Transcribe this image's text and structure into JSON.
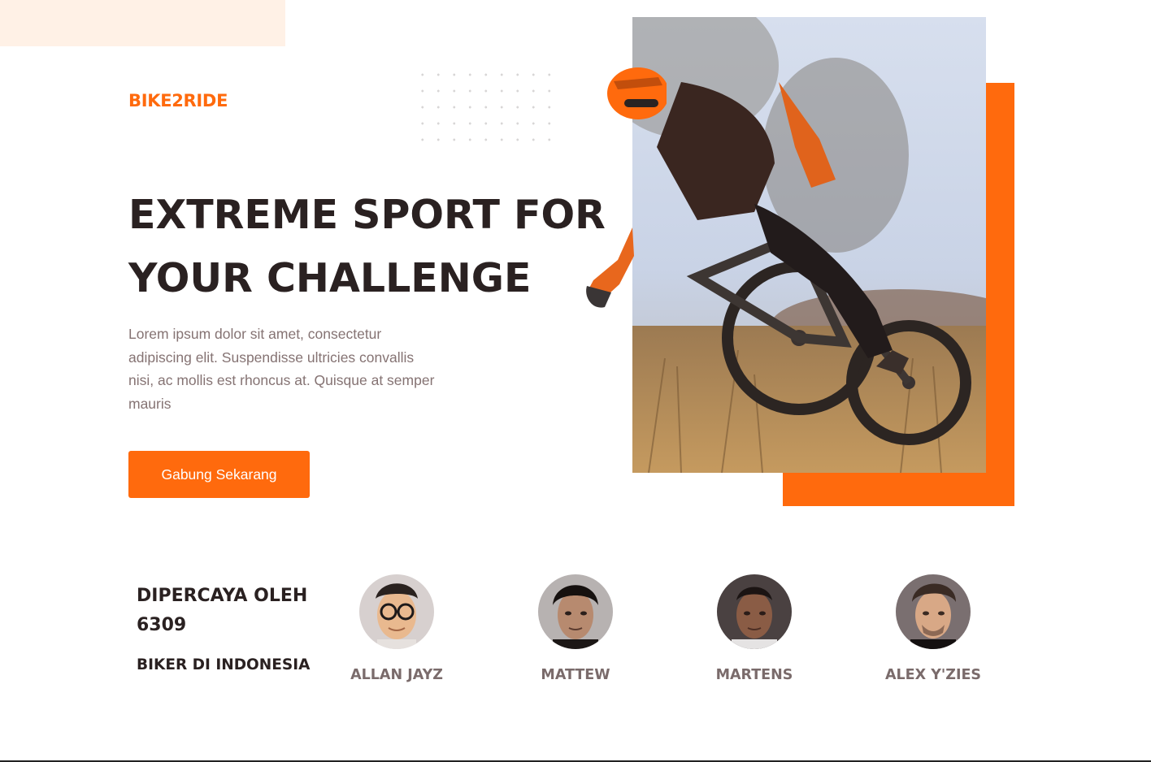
{
  "brand": {
    "name": "BIKE2RIDE",
    "accent": "#ff6a0d"
  },
  "hero": {
    "headline_line1": "EXTREME SPORT FOR",
    "headline_line2": "YOUR CHALLENGE",
    "lead": "Lorem ipsum dolor sit amet, consectetur adipiscing elit. Suspendisse ultricies convallis nisi, ac mollis est rhoncus at. Quisque at semper mauris",
    "cta_label": "Gabung Sekarang",
    "image_icon": "mountain-biker-photo"
  },
  "trust": {
    "line1": "DIPERCAYA OLEH 6309",
    "line2": "BIKER DI INDONESIA"
  },
  "people": [
    {
      "name": "ALLAN JAYZ",
      "icon": "avatar-glasses"
    },
    {
      "name": "MATTEW",
      "icon": "avatar"
    },
    {
      "name": "MARTENS",
      "icon": "avatar"
    },
    {
      "name": "ALEX Y'ZIES",
      "icon": "avatar"
    }
  ]
}
